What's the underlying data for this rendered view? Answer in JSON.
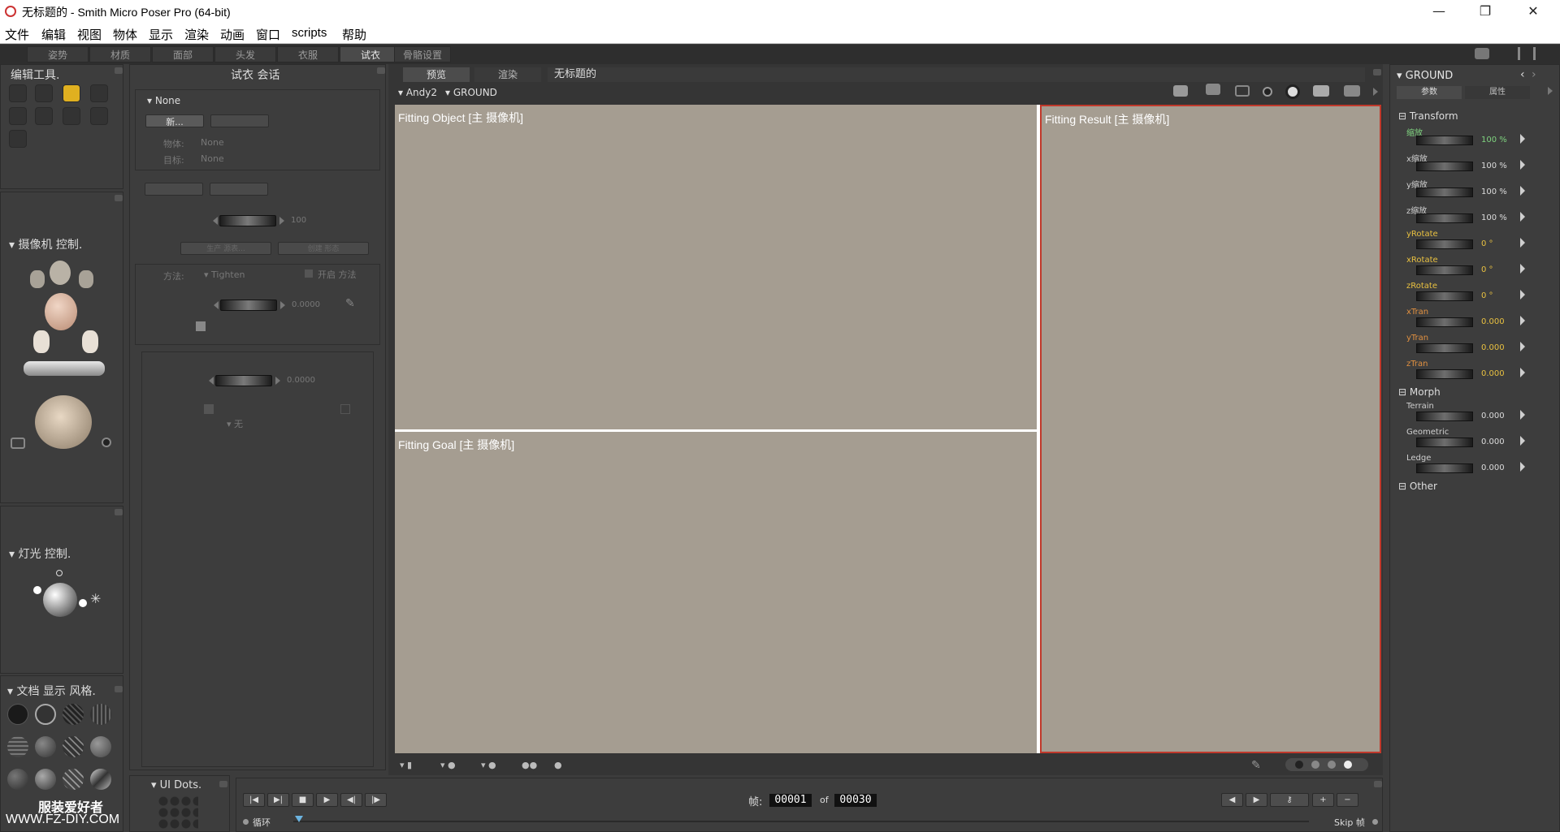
{
  "window": {
    "title": "无标题的 - Smith Micro Poser Pro  (64-bit)"
  },
  "menu": [
    "文件",
    "编辑",
    "视图",
    "物体",
    "显示",
    "渲染",
    "动画",
    "窗口",
    "scripts",
    "帮助"
  ],
  "room_tabs": [
    "姿势",
    "材质",
    "面部",
    "头发",
    "衣服",
    "试衣",
    "骨骼设置"
  ],
  "active_room": "试衣",
  "editing_tools": {
    "title": "编辑工具."
  },
  "camera_controls": {
    "title": "摄像机 控制."
  },
  "light_controls": {
    "title": "灯光 控制."
  },
  "doc_display": {
    "title": "文档 显示 风格."
  },
  "ui_dots": {
    "title": "UI Dots."
  },
  "watermark": {
    "line1": "服装爱好者",
    "line2": "WWW.FZ-DIY.COM"
  },
  "cloth_session": {
    "title": "试衣 会话",
    "selector": "None",
    "new_button": "新...",
    "object_label": "物体:",
    "object_value": "None",
    "target_label": "目标:",
    "target_value": "None",
    "dial1_value": "100",
    "btn_a": "生产 源表...",
    "btn_b": "创建 形态",
    "method_label": "方法:",
    "method_value": "Tighten",
    "enable_label": "开启 方法",
    "dial2_value": "0.0000",
    "dial3_value": "0.0000",
    "none_label": "无"
  },
  "viewport": {
    "tab_preview": "预览",
    "tab_render": "渲染",
    "doc_name": "无标题的",
    "figure": "Andy2",
    "actor": "GROUND",
    "labels": {
      "object": "Fitting Object [主 摄像机]",
      "goal": "Fitting Goal [主 摄像机]",
      "result": "Fitting Result [主 摄像机]"
    },
    "bg_color": "#a59d91",
    "result_border": "#c0392b"
  },
  "timeline": {
    "frame_label": "帧:",
    "current_frame": "00001",
    "of_label": "of",
    "total_frames": "00030",
    "loop_label": "循环",
    "skip_label": "Skip 帧"
  },
  "params": {
    "actor": "GROUND",
    "tab_params": "参数",
    "tab_props": "属性",
    "groups": {
      "transform": "Transform",
      "morph": "Morph",
      "other": "Other"
    },
    "transform": [
      {
        "name": "缩放",
        "value": "100 %"
      },
      {
        "name": "x缩放",
        "value": "100 %"
      },
      {
        "name": "y缩放",
        "value": "100 %"
      },
      {
        "name": "z缩放",
        "value": "100 %"
      },
      {
        "name": "yRotate",
        "value": "0 °"
      },
      {
        "name": "xRotate",
        "value": "0 °"
      },
      {
        "name": "zRotate",
        "value": "0 °"
      },
      {
        "name": "xTran",
        "value": "0.000"
      },
      {
        "name": "yTran",
        "value": "0.000"
      },
      {
        "name": "zTran",
        "value": "0.000"
      }
    ],
    "morph": [
      {
        "name": "Terrain",
        "value": "0.000"
      },
      {
        "name": "Geometric",
        "value": "0.000"
      },
      {
        "name": "Ledge",
        "value": "0.000"
      }
    ]
  }
}
